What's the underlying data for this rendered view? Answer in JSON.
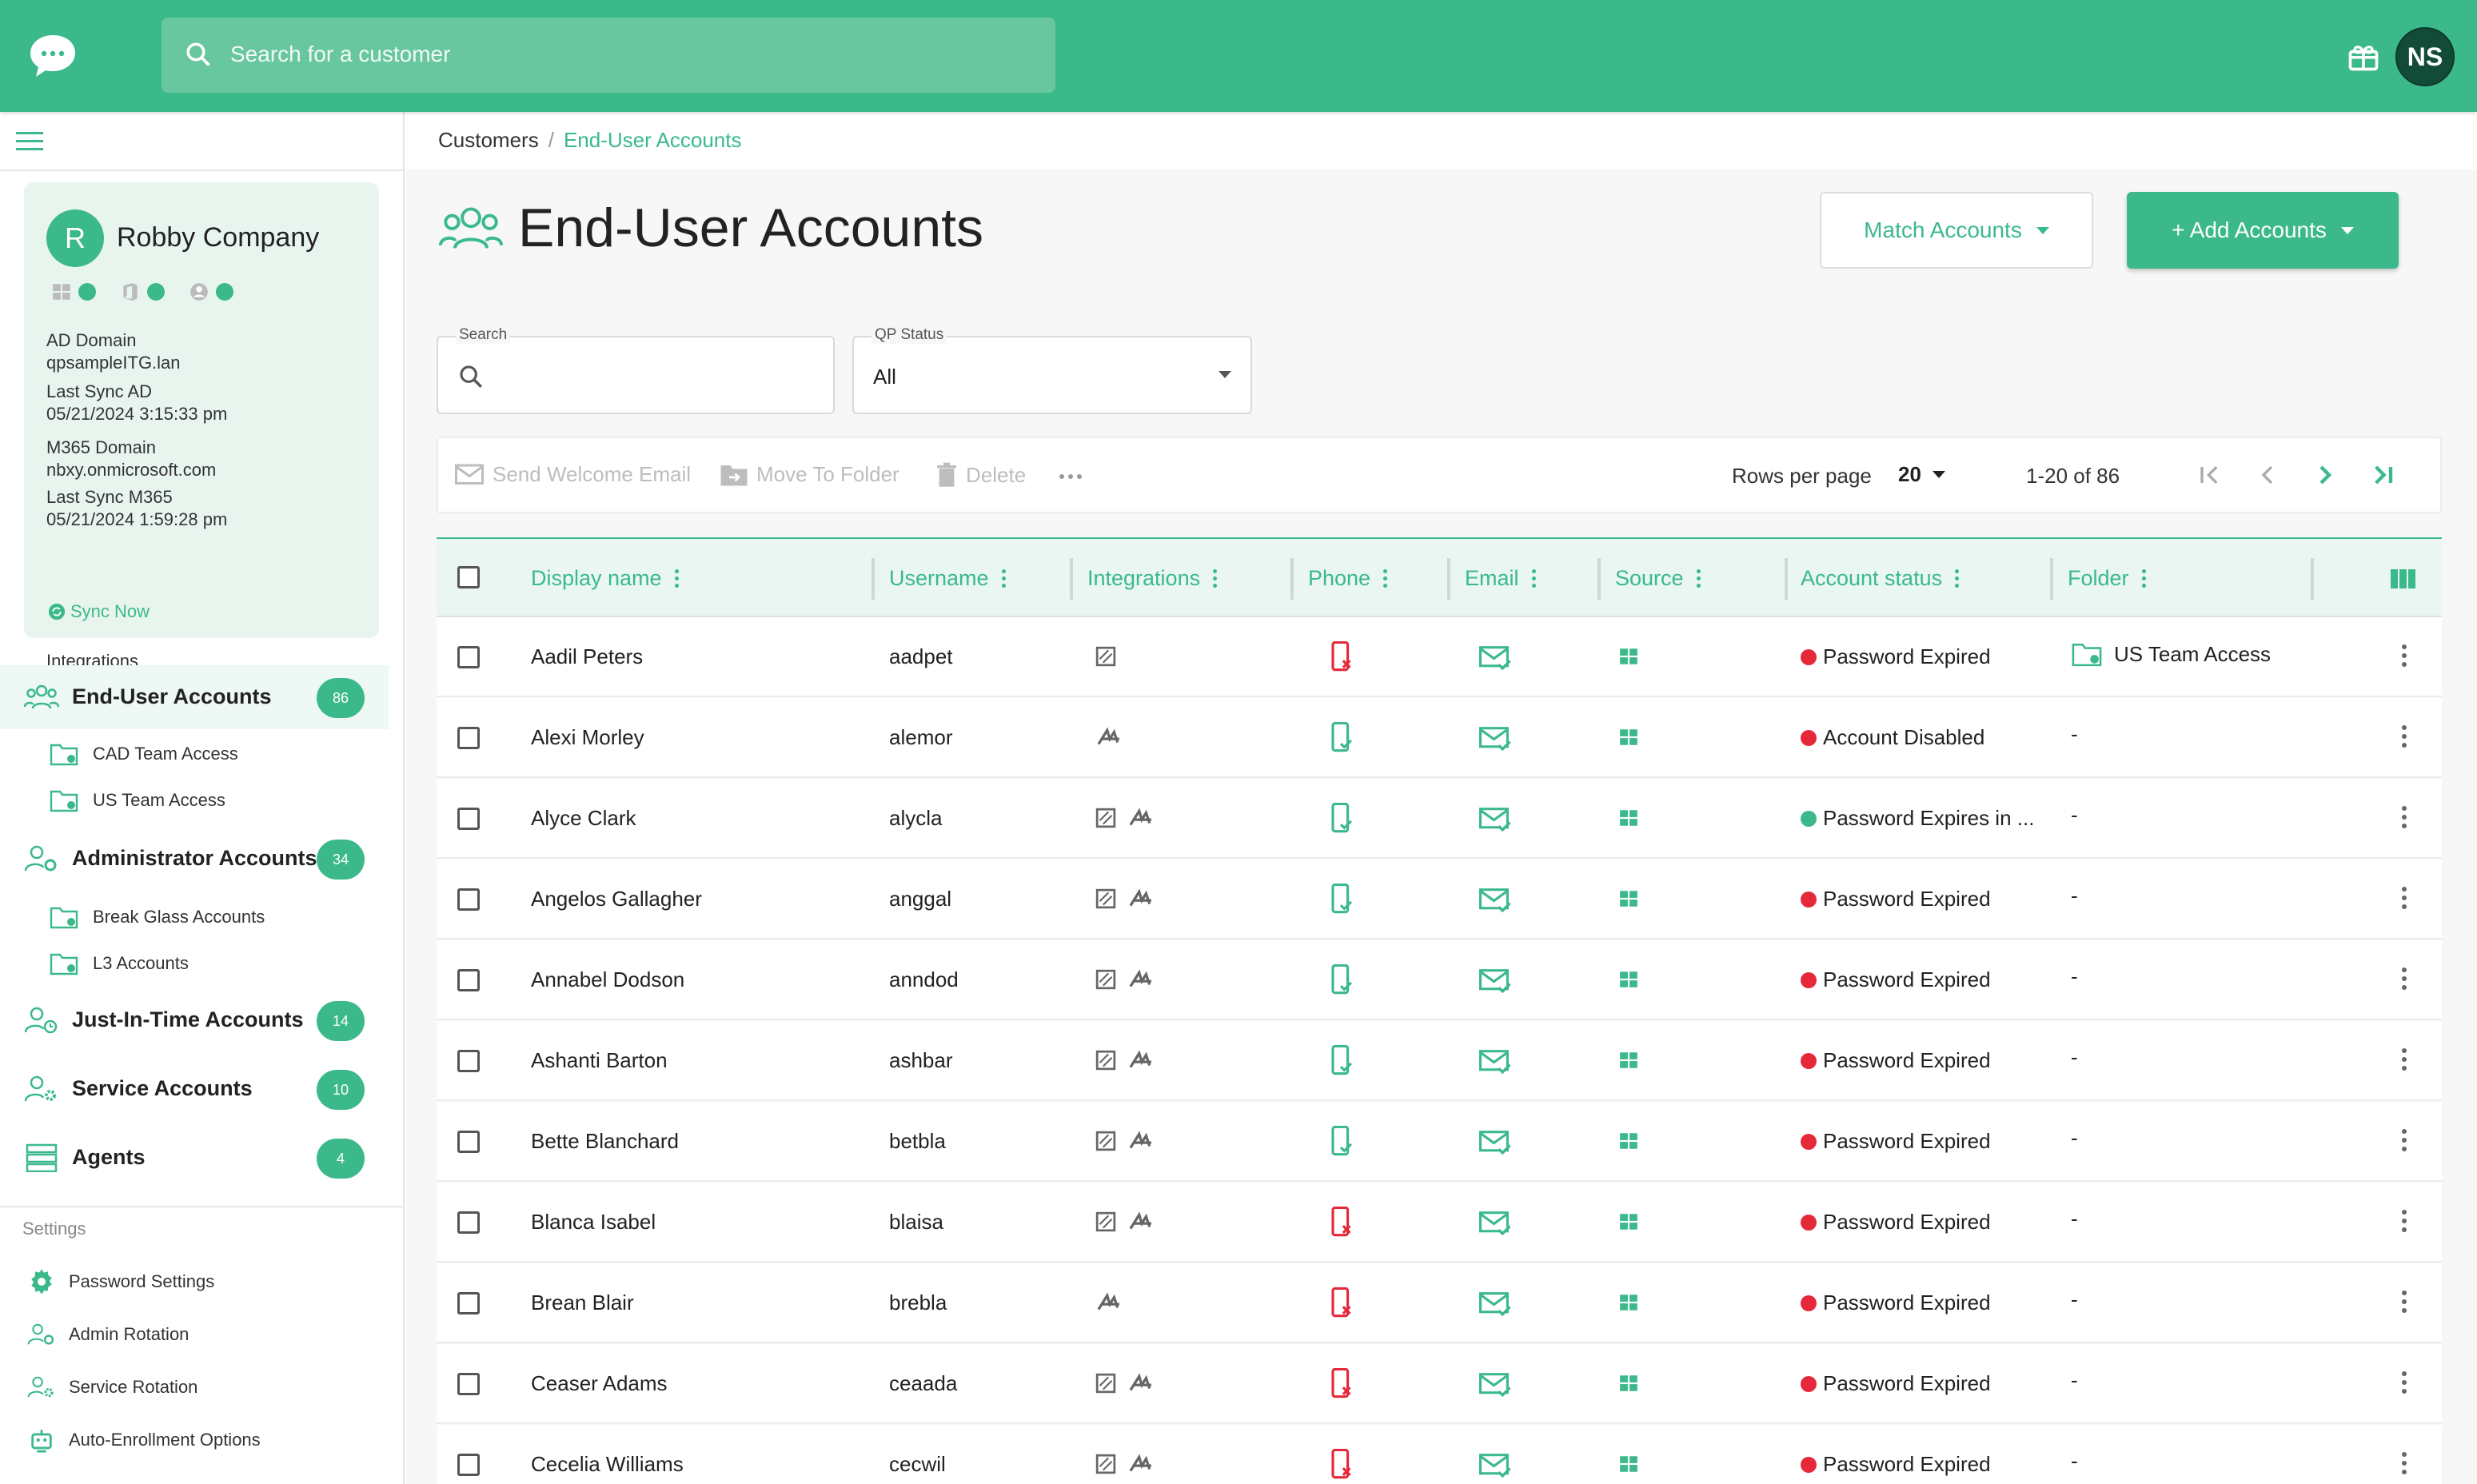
{
  "colors": {
    "accent": "#3bb98b",
    "danger": "#e5293a",
    "dark_green": "#124b37"
  },
  "topbar": {
    "search_placeholder": "Search for a customer",
    "avatar_initials": "NS"
  },
  "sidebar": {
    "company": {
      "initial": "R",
      "name": "Robby Company",
      "ad_domain_label": "AD Domain",
      "ad_domain": "qpsampleITG.lan",
      "last_sync_ad_label": "Last Sync AD",
      "last_sync_ad": "05/21/2024 3:15:33 pm",
      "m365_domain_label": "M365 Domain",
      "m365_domain": "nbxy.onmicrosoft.com",
      "last_sync_m365_label": "Last Sync M365",
      "last_sync_m365": "05/21/2024 1:59:28 pm",
      "sync_now": "Sync Now",
      "integrations_label": "Integrations"
    },
    "nav": [
      {
        "label": "End-User Accounts",
        "badge": "86"
      },
      {
        "label": "Administrator Accounts",
        "badge": "34"
      },
      {
        "label": "Just-In-Time Accounts",
        "badge": "14"
      },
      {
        "label": "Service Accounts",
        "badge": "10"
      },
      {
        "label": "Agents",
        "badge": "4"
      }
    ],
    "sub_end_user": [
      "CAD Team Access",
      "US Team Access"
    ],
    "sub_admin": [
      "Break Glass Accounts",
      "L3 Accounts"
    ],
    "settings_title": "Settings",
    "settings": [
      "Password Settings",
      "Admin Rotation",
      "Service Rotation",
      "Auto-Enrollment Options"
    ]
  },
  "breadcrumb": {
    "root": "Customers",
    "separator": "/",
    "current": "End-User Accounts"
  },
  "page": {
    "title": "End-User Accounts",
    "match_label": "Match Accounts",
    "add_label": "+ Add Accounts"
  },
  "filters": {
    "search_label": "Search",
    "status_label": "QP Status",
    "status_value": "All"
  },
  "toolbar": {
    "send_welcome": "Send Welcome Email",
    "move_folder": "Move To Folder",
    "delete": "Delete",
    "rows_per_page_label": "Rows per page",
    "rows_per_page": "20",
    "range": "1-20 of 86"
  },
  "table": {
    "columns": [
      "Display name",
      "Username",
      "Integrations",
      "Phone",
      "Email",
      "Source",
      "Account status",
      "Folder"
    ],
    "rows": [
      {
        "name": "Aadil Peters",
        "user": "aadpet",
        "integ": [
          "itglue"
        ],
        "phone": "bad",
        "status": "Password Expired",
        "status_color": "#e5293a",
        "folder": "US Team Access"
      },
      {
        "name": "Alexi Morley",
        "user": "alemor",
        "integ": [
          "sig"
        ],
        "phone": "ok",
        "status": "Account Disabled",
        "status_color": "#e5293a",
        "folder": "-"
      },
      {
        "name": "Alyce Clark",
        "user": "alycla",
        "integ": [
          "itglue",
          "sig"
        ],
        "phone": "ok",
        "status": "Password Expires in ...",
        "status_color": "#3bb98b",
        "folder": "-"
      },
      {
        "name": "Angelos Gallagher",
        "user": "anggal",
        "integ": [
          "itglue",
          "sig"
        ],
        "phone": "ok",
        "status": "Password Expired",
        "status_color": "#e5293a",
        "folder": "-"
      },
      {
        "name": "Annabel Dodson",
        "user": "anndod",
        "integ": [
          "itglue",
          "sig"
        ],
        "phone": "ok",
        "status": "Password Expired",
        "status_color": "#e5293a",
        "folder": "-"
      },
      {
        "name": "Ashanti Barton",
        "user": "ashbar",
        "integ": [
          "itglue",
          "sig"
        ],
        "phone": "ok",
        "status": "Password Expired",
        "status_color": "#e5293a",
        "folder": "-"
      },
      {
        "name": "Bette Blanchard",
        "user": "betbla",
        "integ": [
          "itglue",
          "sig"
        ],
        "phone": "ok",
        "status": "Password Expired",
        "status_color": "#e5293a",
        "folder": "-"
      },
      {
        "name": "Blanca Isabel",
        "user": "blaisa",
        "integ": [
          "itglue",
          "sig"
        ],
        "phone": "bad",
        "status": "Password Expired",
        "status_color": "#e5293a",
        "folder": "-"
      },
      {
        "name": "Brean Blair",
        "user": "brebla",
        "integ": [
          "sig"
        ],
        "phone": "bad",
        "status": "Password Expired",
        "status_color": "#e5293a",
        "folder": "-"
      },
      {
        "name": "Ceaser Adams",
        "user": "ceaada",
        "integ": [
          "itglue",
          "sig"
        ],
        "phone": "bad",
        "status": "Password Expired",
        "status_color": "#e5293a",
        "folder": "-"
      },
      {
        "name": "Cecelia Williams",
        "user": "cecwil",
        "integ": [
          "itglue",
          "sig"
        ],
        "phone": "bad",
        "status": "Password Expired",
        "status_color": "#e5293a",
        "folder": "-"
      }
    ]
  }
}
